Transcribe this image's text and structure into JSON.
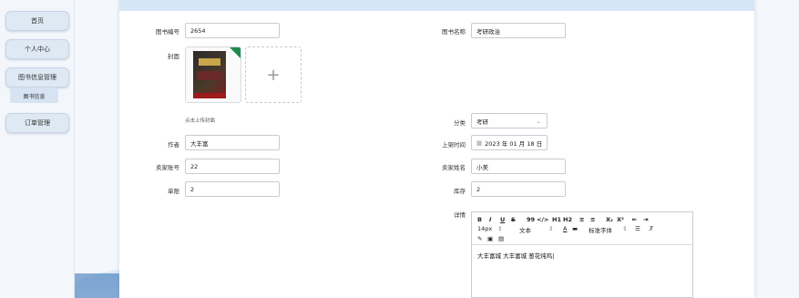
{
  "sidebar": {
    "items": [
      {
        "label": "首页"
      },
      {
        "label": "个人中心"
      },
      {
        "label": "图书信息管理"
      },
      {
        "label": "订单管理"
      }
    ],
    "sub_item": "图书信息"
  },
  "form": {
    "book_no_label": "图书编号",
    "book_no_value": "2654",
    "book_name_label": "图书名称",
    "book_name_value": "考研政治",
    "cover_label": "封面",
    "upload_hint": "点击上传封面",
    "upload_icon": "+",
    "category_label": "分类",
    "category_value": "考研",
    "author_label": "作者",
    "author_value": "大丰富",
    "date_label": "上架时间",
    "date_value": "2023 年 01 月 18 日",
    "seller_acc_label": "卖家账号",
    "seller_acc_value": "22",
    "seller_name_label": "卖家姓名",
    "seller_name_value": "小美",
    "limit_label": "单限",
    "limit_value": "2",
    "stock_label": "库存",
    "stock_value": "2",
    "detail_label": "详情"
  },
  "editor": {
    "toolbar_row1": [
      "B",
      "I",
      "U",
      "S",
      "99",
      "</>",
      "H1",
      "H2",
      "≡",
      "≡",
      "X₂",
      "X²",
      "⇤",
      "⇥"
    ],
    "font_size": "14px",
    "text_style": "文本",
    "font_color": "A",
    "font_family": "标准字体",
    "content": "大丰富城 大丰富城 葱花炖鸡"
  },
  "icons": [
    "calendar-icon",
    "chevron-down-icon",
    "plus-icon",
    "link-icon",
    "image-icon",
    "video-icon"
  ],
  "colors": {
    "accent": "#d6e6f7",
    "sidebar": "#dfe9f4",
    "corner": "#1f8a4c"
  }
}
